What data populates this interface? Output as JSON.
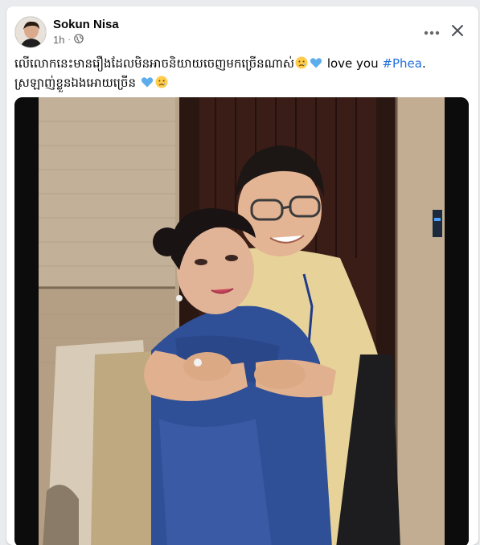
{
  "post": {
    "author": "Sokun Nisa",
    "time": "1h",
    "privacy_icon": "globe-icon",
    "caption_line1": "លើលោកនេះមានរឿងដែលមិនអាចនិយាយចេញមកច្រើនណាស់",
    "caption_love": "love you",
    "caption_hashtag": "#Phea",
    "caption_period": ".",
    "caption_line2": "ស្រឡាញ់ខ្លួនឯងអោយច្រើន",
    "emojis": [
      "sad-face-icon",
      "blue-heart-icon"
    ]
  },
  "controls": {
    "more_icon": "more-options-icon",
    "close_icon": "close-icon"
  },
  "colors": {
    "hashtag": "#216fdb",
    "meta_text": "#65676b",
    "card_bg": "#ffffff",
    "page_bg": "#e9ebee"
  }
}
